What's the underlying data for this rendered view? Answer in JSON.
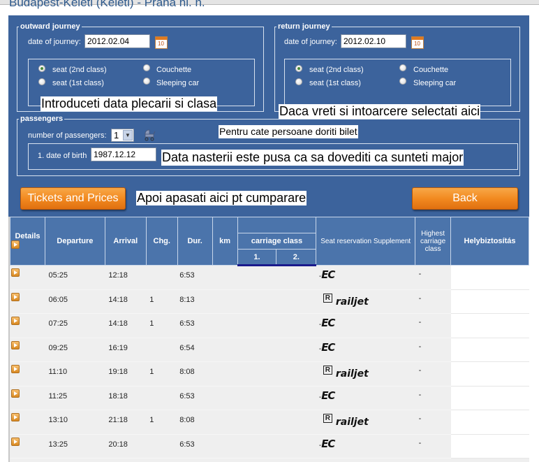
{
  "page_title": "Budapest-Keleti (Keleti) - Praha hl. n.",
  "outward": {
    "legend": "outward journey",
    "date_label": "date of journey:",
    "date_value": "2012.02.04",
    "classes": [
      {
        "label": "seat (2nd class)",
        "checked": true
      },
      {
        "label": "seat (1st class)",
        "checked": false
      },
      {
        "label": "Couchette",
        "checked": false
      },
      {
        "label": "Sleeping car",
        "checked": false
      }
    ]
  },
  "return": {
    "legend": "return journey",
    "date_label": "date of journey:",
    "date_value": "2012.02.10",
    "classes": [
      {
        "label": "seat (2nd class)",
        "checked": true
      },
      {
        "label": "seat (1st class)",
        "checked": false
      },
      {
        "label": "Couchette",
        "checked": false
      },
      {
        "label": "Sleeping car",
        "checked": false
      }
    ]
  },
  "passengers": {
    "legend": "passengers",
    "count_label": "number of passengers:",
    "count_value": "1",
    "dob_label": "1. date of birth",
    "dob_value": "1987.12.12"
  },
  "calendar_icon_text": "10",
  "annotations": {
    "outward": "Introduceti data plecarii si clasa",
    "return": "Daca vreti si intoarcere selectati aici",
    "passengers": "Pentru cate persoane doriti bilet",
    "dob": "Data nasterii este pusa ca sa dovediti ca sunteti major",
    "tickets": "Apoi apasati aici pt cumparare"
  },
  "buttons": {
    "tickets": "Tickets and Prices",
    "back": "Back"
  },
  "table": {
    "headers": {
      "details": "Details",
      "departure": "Departure",
      "arrival": "Arrival",
      "changes": "Chg.",
      "duration": "Dur.",
      "km": "km",
      "carriage_class": "carriage class",
      "class1": "1.",
      "class2": "2.",
      "seat_res": "Seat reservation Supplement",
      "highest": "Highest carriage class",
      "hely": "Helybiztosítás"
    },
    "rows": [
      {
        "dep": "05:25",
        "arr": "12:18",
        "chg": "",
        "dur": "6:53",
        "train": "EC",
        "highest": "-"
      },
      {
        "dep": "06:05",
        "arr": "14:18",
        "chg": "1",
        "dur": "8:13",
        "train": "railjet",
        "highest": "-"
      },
      {
        "dep": "07:25",
        "arr": "14:18",
        "chg": "1",
        "dur": "6:53",
        "train": "EC",
        "highest": "-"
      },
      {
        "dep": "09:25",
        "arr": "16:19",
        "chg": "",
        "dur": "6:54",
        "train": "EC",
        "highest": "-"
      },
      {
        "dep": "11:10",
        "arr": "19:18",
        "chg": "1",
        "dur": "8:08",
        "train": "railjet",
        "highest": "-"
      },
      {
        "dep": "11:25",
        "arr": "18:18",
        "chg": "",
        "dur": "6:53",
        "train": "EC",
        "highest": "-"
      },
      {
        "dep": "13:10",
        "arr": "21:18",
        "chg": "1",
        "dur": "8:08",
        "train": "railjet",
        "highest": "-"
      },
      {
        "dep": "13:25",
        "arr": "20:18",
        "chg": "",
        "dur": "6:53",
        "train": "EC",
        "highest": "-"
      }
    ]
  },
  "colors": {
    "panel_bg": "#3c639c",
    "header_bg": "#4b74ab",
    "button_orange": "#f28a20"
  }
}
